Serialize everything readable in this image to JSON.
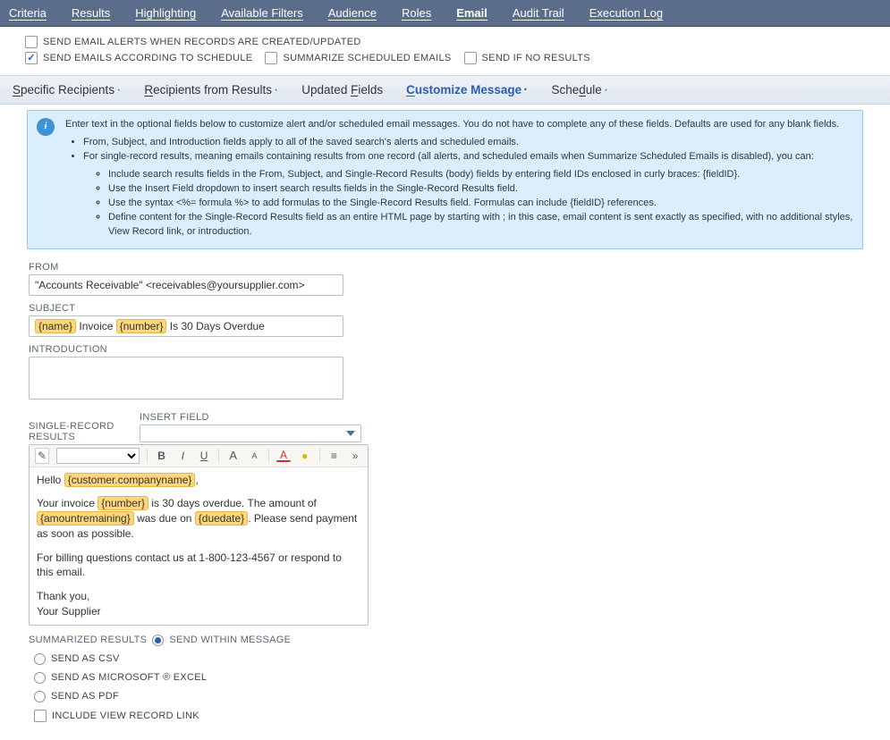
{
  "tabs": {
    "items": [
      "Criteria",
      "Results",
      "Highlighting",
      "Available Filters",
      "Audience",
      "Roles",
      "Email",
      "Audit Trail",
      "Execution Log"
    ],
    "active": 6
  },
  "topChecks": {
    "sendAlerts": {
      "label": "SEND EMAIL ALERTS WHEN RECORDS ARE CREATED/UPDATED",
      "checked": false
    },
    "sendSchedule": {
      "label": "SEND EMAILS ACCORDING TO SCHEDULE",
      "checked": true
    },
    "summarize": {
      "label": "SUMMARIZE SCHEDULED EMAILS",
      "checked": false
    },
    "sendIfNone": {
      "label": "SEND IF NO RESULTS",
      "checked": false
    }
  },
  "subtabs": {
    "items": [
      {
        "label": "Specific Recipients",
        "u": "S",
        "rest": "pecific Recipients",
        "dot": true
      },
      {
        "label": "Recipients from Results",
        "u": "R",
        "rest": "ecipients from Results",
        "dot": true
      },
      {
        "label": "Updated Fields",
        "u": "",
        "rest": "Updated ",
        "u2": "F",
        "rest2": "ields",
        "dot": false
      },
      {
        "label": "Customize Message",
        "u": "C",
        "rest": "ustomize Message",
        "dot": true
      },
      {
        "label": "Schedule",
        "u": "",
        "rest": "Sche",
        "u2": "d",
        "rest2": "ule",
        "dot": true
      }
    ],
    "active": 3
  },
  "info": {
    "headline": "Enter text in the optional fields below to customize alert and/or scheduled email messages. You do not have to complete any of these fields. Defaults are used for any blank fields.",
    "b1": "From, Subject, and Introduction fields apply to all of the saved search's alerts and scheduled emails.",
    "b2": "For single-record results, meaning emails containing results from one record (all alerts, and scheduled emails when Summarize Scheduled Emails is disabled), you can:",
    "s1": "Include search results fields in the From, Subject, and Single-Record Results (body) fields by entering field IDs enclosed in curly braces: {fieldID}.",
    "s2": "Use the Insert Field dropdown to insert search results fields in the Single-Record Results field.",
    "s3": "Use the syntax <%= formula %> to add formulas to the Single-Record Results field. Formulas can include {fieldID} references.",
    "s4": "Define content for the Single-Record Results field as an entire HTML page by starting with ; in this case, email content is sent exactly as specified, with no additional styles, View Record link, or introduction."
  },
  "form": {
    "fromLabel": "FROM",
    "fromValue": "\"Accounts Receivable\" <receivables@yoursupplier.com>",
    "subjectLabel": "SUBJECT",
    "subject_pre": "",
    "subject_tok1": "{name}",
    "subject_mid": " Invoice ",
    "subject_tok2": "{number}",
    "subject_post": " Is 30 Days Overdue",
    "introLabel": "INTRODUCTION",
    "insertFieldLabel": "INSERT FIELD",
    "srrLabel": "SINGLE-RECORD RESULTS",
    "body": {
      "p1a": "Hello ",
      "p1t": "{customer.companyname}",
      "p1b": ",",
      "p2a": "Your invoice ",
      "p2t1": "{number}",
      "p2b": " is 30 days overdue. The amount of ",
      "p2t2": "{amountremaining}",
      "p2c": " was due on ",
      "p2t3": "{duedate}",
      "p2d": ". Please send payment as soon as possible.",
      "p3": "For billing questions contact us at 1-800-123-4567 or respond to this email.",
      "p4a": "Thank you,",
      "p4b": "Your Supplier"
    }
  },
  "summary": {
    "label": "SUMMARIZED RESULTS",
    "within": "SEND WITHIN MESSAGE",
    "csv": "SEND AS CSV",
    "excel": "SEND AS MICROSOFT ® EXCEL",
    "pdf": "SEND AS PDF",
    "viewlink": "INCLUDE VIEW RECORD LINK"
  },
  "toolbarIcons": {
    "bold": "B",
    "italic": "I",
    "underline": "U",
    "aplus": "A",
    "aminus": "A",
    "fontcolor": "A",
    "hilite": "●",
    "align": "≡",
    "more": "»",
    "src": "✎"
  }
}
